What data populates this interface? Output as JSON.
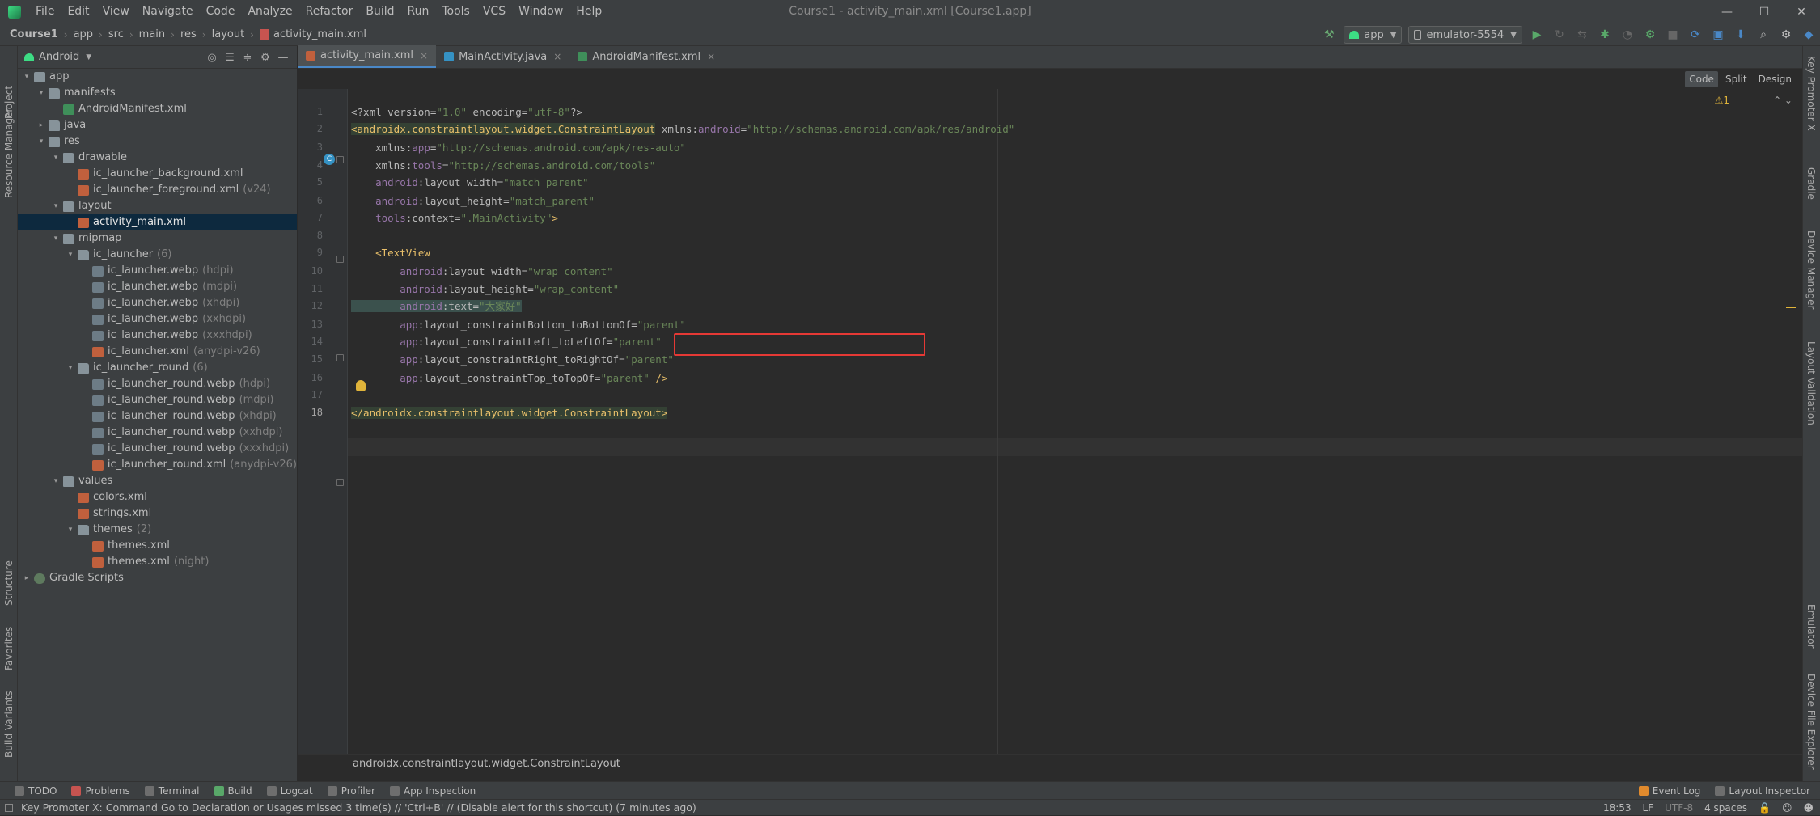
{
  "menubar": {
    "items": [
      "File",
      "Edit",
      "View",
      "Navigate",
      "Code",
      "Analyze",
      "Refactor",
      "Build",
      "Run",
      "Tools",
      "VCS",
      "Window",
      "Help"
    ],
    "window_title": "Course1 - activity_main.xml [Course1.app]"
  },
  "breadcrumb": [
    "Course1",
    "app",
    "src",
    "main",
    "res",
    "layout",
    "activity_main.xml"
  ],
  "toolbar": {
    "run_config": "app",
    "device": "emulator-5554"
  },
  "left_strip": [
    "Project",
    "Resource Manager",
    "Structure",
    "Favorites",
    "Build Variants"
  ],
  "right_strip": [
    "Key Promoter X",
    "Gradle",
    "Device Manager",
    "Layout Validation",
    "Emulator",
    "Device File Explorer"
  ],
  "project_panel": {
    "title": "Android",
    "tree": [
      {
        "label": "app",
        "hint": "",
        "depth": 0,
        "arrow": "▾",
        "icon": "appf"
      },
      {
        "label": "manifests",
        "hint": "",
        "depth": 1,
        "arrow": "▾",
        "icon": "folder"
      },
      {
        "label": "AndroidManifest.xml",
        "hint": "",
        "depth": 2,
        "arrow": "",
        "icon": "mf"
      },
      {
        "label": "java",
        "hint": "",
        "depth": 1,
        "arrow": "▸",
        "icon": "folder"
      },
      {
        "label": "res",
        "hint": "",
        "depth": 1,
        "arrow": "▾",
        "icon": "folder"
      },
      {
        "label": "drawable",
        "hint": "",
        "depth": 2,
        "arrow": "▾",
        "icon": "folder"
      },
      {
        "label": "ic_launcher_background.xml",
        "hint": "",
        "depth": 3,
        "arrow": "",
        "icon": "xml"
      },
      {
        "label": "ic_launcher_foreground.xml",
        "hint": "(v24)",
        "depth": 3,
        "arrow": "",
        "icon": "xml"
      },
      {
        "label": "layout",
        "hint": "",
        "depth": 2,
        "arrow": "▾",
        "icon": "folder"
      },
      {
        "label": "activity_main.xml",
        "hint": "",
        "depth": 3,
        "arrow": "",
        "icon": "xml",
        "selected": true
      },
      {
        "label": "mipmap",
        "hint": "",
        "depth": 2,
        "arrow": "▾",
        "icon": "folder"
      },
      {
        "label": "ic_launcher",
        "hint": "(6)",
        "depth": 3,
        "arrow": "▾",
        "icon": "folder"
      },
      {
        "label": "ic_launcher.webp",
        "hint": "(hdpi)",
        "depth": 4,
        "arrow": "",
        "icon": "webp"
      },
      {
        "label": "ic_launcher.webp",
        "hint": "(mdpi)",
        "depth": 4,
        "arrow": "",
        "icon": "webp"
      },
      {
        "label": "ic_launcher.webp",
        "hint": "(xhdpi)",
        "depth": 4,
        "arrow": "",
        "icon": "webp"
      },
      {
        "label": "ic_launcher.webp",
        "hint": "(xxhdpi)",
        "depth": 4,
        "arrow": "",
        "icon": "webp"
      },
      {
        "label": "ic_launcher.webp",
        "hint": "(xxxhdpi)",
        "depth": 4,
        "arrow": "",
        "icon": "webp"
      },
      {
        "label": "ic_launcher.xml",
        "hint": "(anydpi-v26)",
        "depth": 4,
        "arrow": "",
        "icon": "xml"
      },
      {
        "label": "ic_launcher_round",
        "hint": "(6)",
        "depth": 3,
        "arrow": "▾",
        "icon": "folder"
      },
      {
        "label": "ic_launcher_round.webp",
        "hint": "(hdpi)",
        "depth": 4,
        "arrow": "",
        "icon": "webp"
      },
      {
        "label": "ic_launcher_round.webp",
        "hint": "(mdpi)",
        "depth": 4,
        "arrow": "",
        "icon": "webp"
      },
      {
        "label": "ic_launcher_round.webp",
        "hint": "(xhdpi)",
        "depth": 4,
        "arrow": "",
        "icon": "webp"
      },
      {
        "label": "ic_launcher_round.webp",
        "hint": "(xxhdpi)",
        "depth": 4,
        "arrow": "",
        "icon": "webp"
      },
      {
        "label": "ic_launcher_round.webp",
        "hint": "(xxxhdpi)",
        "depth": 4,
        "arrow": "",
        "icon": "webp"
      },
      {
        "label": "ic_launcher_round.xml",
        "hint": "(anydpi-v26)",
        "depth": 4,
        "arrow": "",
        "icon": "xml"
      },
      {
        "label": "values",
        "hint": "",
        "depth": 2,
        "arrow": "▾",
        "icon": "folder"
      },
      {
        "label": "colors.xml",
        "hint": "",
        "depth": 3,
        "arrow": "",
        "icon": "xml"
      },
      {
        "label": "strings.xml",
        "hint": "",
        "depth": 3,
        "arrow": "",
        "icon": "xml"
      },
      {
        "label": "themes",
        "hint": "(2)",
        "depth": 3,
        "arrow": "▾",
        "icon": "folder"
      },
      {
        "label": "themes.xml",
        "hint": "",
        "depth": 4,
        "arrow": "",
        "icon": "xml"
      },
      {
        "label": "themes.xml",
        "hint": "(night)",
        "depth": 4,
        "arrow": "",
        "icon": "xml"
      },
      {
        "label": "Gradle Scripts",
        "hint": "",
        "depth": 0,
        "arrow": "▸",
        "icon": "gradle"
      }
    ]
  },
  "editor": {
    "tabs": [
      {
        "label": "activity_main.xml",
        "active": true,
        "icon_color": "#c0603d"
      },
      {
        "label": "MainActivity.java",
        "active": false,
        "icon_color": "#3592c4"
      },
      {
        "label": "AndroidManifest.xml",
        "active": false,
        "icon_color": "#3f8f5a"
      }
    ],
    "view_modes": [
      "Code",
      "Split",
      "Design"
    ],
    "warning_count": "⚠1",
    "line_numbers": [
      "1",
      "2",
      "3",
      "4",
      "5",
      "6",
      "7",
      "8",
      "9",
      "10",
      "11",
      "12",
      "13",
      "14",
      "15",
      "16",
      "17",
      "18"
    ],
    "lines": [
      [
        [
          "t-pi",
          "<?xml version="
        ],
        [
          "t-val",
          "\"1.0\""
        ],
        [
          "t-pi",
          " encoding="
        ],
        [
          "t-val",
          "\"utf-8\""
        ],
        [
          "t-pi",
          "?>"
        ]
      ],
      [
        [
          "t-tag t-hl",
          "<androidx.constraintlayout.widget.ConstraintLayout"
        ],
        [
          "t-attr",
          " xmlns:"
        ],
        [
          "t-ns",
          "android"
        ],
        [
          "t-attr",
          "="
        ],
        [
          "t-val",
          "\"http://schemas.android.com/apk/res/android\""
        ]
      ],
      [
        [
          "t-attr",
          "    xmlns:"
        ],
        [
          "t-ns",
          "app"
        ],
        [
          "t-attr",
          "="
        ],
        [
          "t-val",
          "\"http://schemas.android.com/apk/res-auto\""
        ]
      ],
      [
        [
          "t-attr",
          "    xmlns:"
        ],
        [
          "t-ns",
          "tools"
        ],
        [
          "t-attr",
          "="
        ],
        [
          "t-val",
          "\"http://schemas.android.com/tools\""
        ]
      ],
      [
        [
          "t-ns",
          "    android"
        ],
        [
          "t-attr",
          ":layout_width="
        ],
        [
          "t-val",
          "\"match_parent\""
        ]
      ],
      [
        [
          "t-ns",
          "    android"
        ],
        [
          "t-attr",
          ":layout_height="
        ],
        [
          "t-val",
          "\"match_parent\""
        ]
      ],
      [
        [
          "t-ns",
          "    tools"
        ],
        [
          "t-attr",
          ":context="
        ],
        [
          "t-val",
          "\".MainActivity\""
        ],
        [
          "t-tag",
          ">"
        ]
      ],
      [
        [
          "t-attr",
          ""
        ]
      ],
      [
        [
          "t-tag",
          "    <TextView"
        ]
      ],
      [
        [
          "t-ns",
          "        android"
        ],
        [
          "t-attr",
          ":layout_width="
        ],
        [
          "t-val",
          "\"wrap_content\""
        ]
      ],
      [
        [
          "t-ns",
          "        android"
        ],
        [
          "t-attr",
          ":layout_height="
        ],
        [
          "t-val",
          "\"wrap_content\""
        ]
      ],
      [
        [
          "t-ns t-selbg",
          "        android"
        ],
        [
          "t-attr t-selbg",
          ":text="
        ],
        [
          "t-val t-selbg",
          "\"大家好\""
        ]
      ],
      [
        [
          "t-ns",
          "        app"
        ],
        [
          "t-attr",
          ":layout_constraintBottom_toBottomOf="
        ],
        [
          "t-val",
          "\"parent\""
        ]
      ],
      [
        [
          "t-ns",
          "        app"
        ],
        [
          "t-attr",
          ":layout_constraintLeft_toLeftOf="
        ],
        [
          "t-val",
          "\"parent\""
        ]
      ],
      [
        [
          "t-ns",
          "        app"
        ],
        [
          "t-attr",
          ":layout_constraintRight_toRightOf="
        ],
        [
          "t-val",
          "\"parent\""
        ]
      ],
      [
        [
          "t-ns",
          "        app"
        ],
        [
          "t-attr",
          ":layout_constraintTop_toTopOf="
        ],
        [
          "t-val",
          "\"parent\""
        ],
        [
          "t-tag",
          " />"
        ]
      ],
      [
        [
          "t-attr",
          ""
        ]
      ],
      [
        [
          "t-tag t-hl",
          "</androidx.constraintlayout.widget.ConstraintLayout>"
        ]
      ]
    ],
    "breadcrumb": "androidx.constraintlayout.widget.ConstraintLayout"
  },
  "bottom_tools": {
    "left": [
      "TODO",
      "Problems",
      "Terminal",
      "Build",
      "Logcat",
      "Profiler",
      "App Inspection"
    ],
    "right": [
      "Event Log",
      "Layout Inspector"
    ]
  },
  "status": {
    "message": "Key Promoter X: Command Go to Declaration or Usages missed 3 time(s) // 'Ctrl+B' // (Disable alert for this shortcut) (7 minutes ago)",
    "position": "18:53",
    "line_sep": "LF",
    "encoding": "UTF-8",
    "indent": "4 spaces"
  },
  "colors": {
    "accent": "#4a88c7",
    "highlight_box": "#e53935",
    "selection": "#0d293e"
  }
}
